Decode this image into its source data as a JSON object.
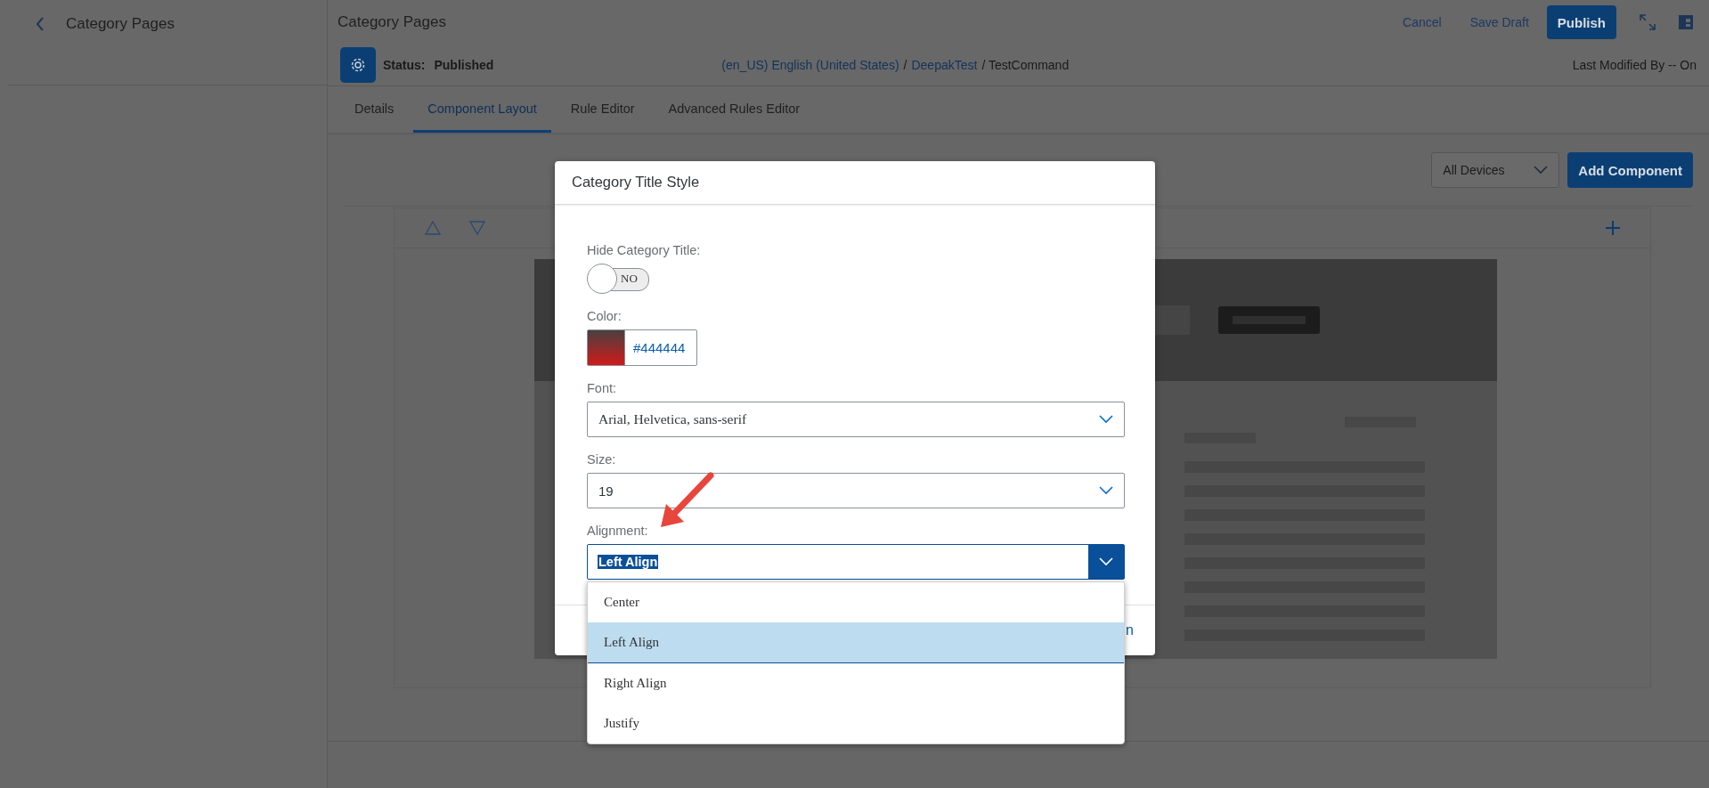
{
  "sidebar": {
    "title": "Category Pages"
  },
  "header": {
    "title": "Category Pages",
    "actions": [
      {
        "label": "Cancel",
        "kind": "link"
      },
      {
        "label": "Save Draft",
        "kind": "link"
      },
      {
        "label": "Publish",
        "kind": "primary"
      }
    ]
  },
  "status_bar": {
    "label": "Status:",
    "value": "Published",
    "breadcrumb": [
      {
        "text": "(en_US) English (United States)",
        "kind": "link"
      },
      {
        "text": "/",
        "kind": "text"
      },
      {
        "text": "DeepakTest",
        "kind": "link"
      },
      {
        "text": "/ TestCommand",
        "kind": "text"
      }
    ],
    "modified": "Last Modified By -- On"
  },
  "tabs": [
    {
      "label": "Details",
      "selected": false
    },
    {
      "label": "Component Layout",
      "selected": true
    },
    {
      "label": "Rule Editor",
      "selected": false
    },
    {
      "label": "Advanced Rules Editor",
      "selected": false
    }
  ],
  "toolbar": {
    "device_select": "All Devices",
    "add_button": "Add Component"
  },
  "dialog": {
    "title": "Category Title Style",
    "fields": [
      {
        "kind": "toggle",
        "label": "Hide Category Title:",
        "on": false,
        "text": "NO"
      },
      {
        "kind": "color",
        "label": "Color:",
        "value": "#444444"
      },
      {
        "kind": "select",
        "label": "Font:",
        "value": "Arial, Helvetica, sans-serif",
        "open": false
      },
      {
        "kind": "select",
        "label": "Size:",
        "value": "19",
        "open": false
      },
      {
        "kind": "select",
        "label": "Alignment:",
        "value": "Left Align",
        "open": true,
        "options": [
          {
            "label": "Center",
            "selected": false
          },
          {
            "label": "Left Align",
            "selected": true
          },
          {
            "label": "Right Align",
            "selected": false
          },
          {
            "label": "Justify",
            "selected": false
          }
        ]
      }
    ],
    "footer_button": "n"
  }
}
